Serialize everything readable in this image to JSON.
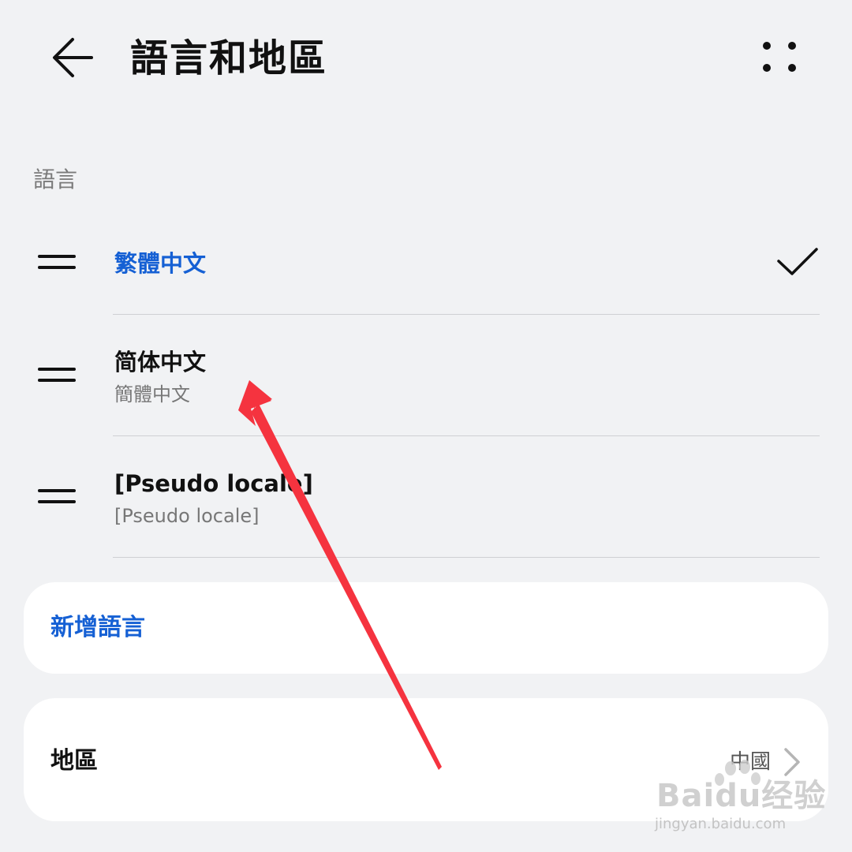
{
  "header": {
    "title": "語言和地區",
    "back_icon": "arrow-left-icon",
    "more_icon": "more-dots-icon"
  },
  "section_label": "語言",
  "languages": [
    {
      "name": "繁體中文",
      "subtitle": "",
      "selected": true
    },
    {
      "name": "简体中文",
      "subtitle": "簡體中文",
      "selected": false
    },
    {
      "name": "[Pseudo locale]",
      "subtitle": "[Pseudo locale]",
      "selected": false
    }
  ],
  "add_language": {
    "label": "新增語言"
  },
  "region": {
    "label": "地區",
    "value": "中國"
  },
  "watermark": {
    "text": "Baidu经验",
    "url": "jingyan.baidu.com"
  },
  "colors": {
    "accent": "#1560d4",
    "annotation_arrow": "#f5333f",
    "background": "#f1f2f4"
  }
}
